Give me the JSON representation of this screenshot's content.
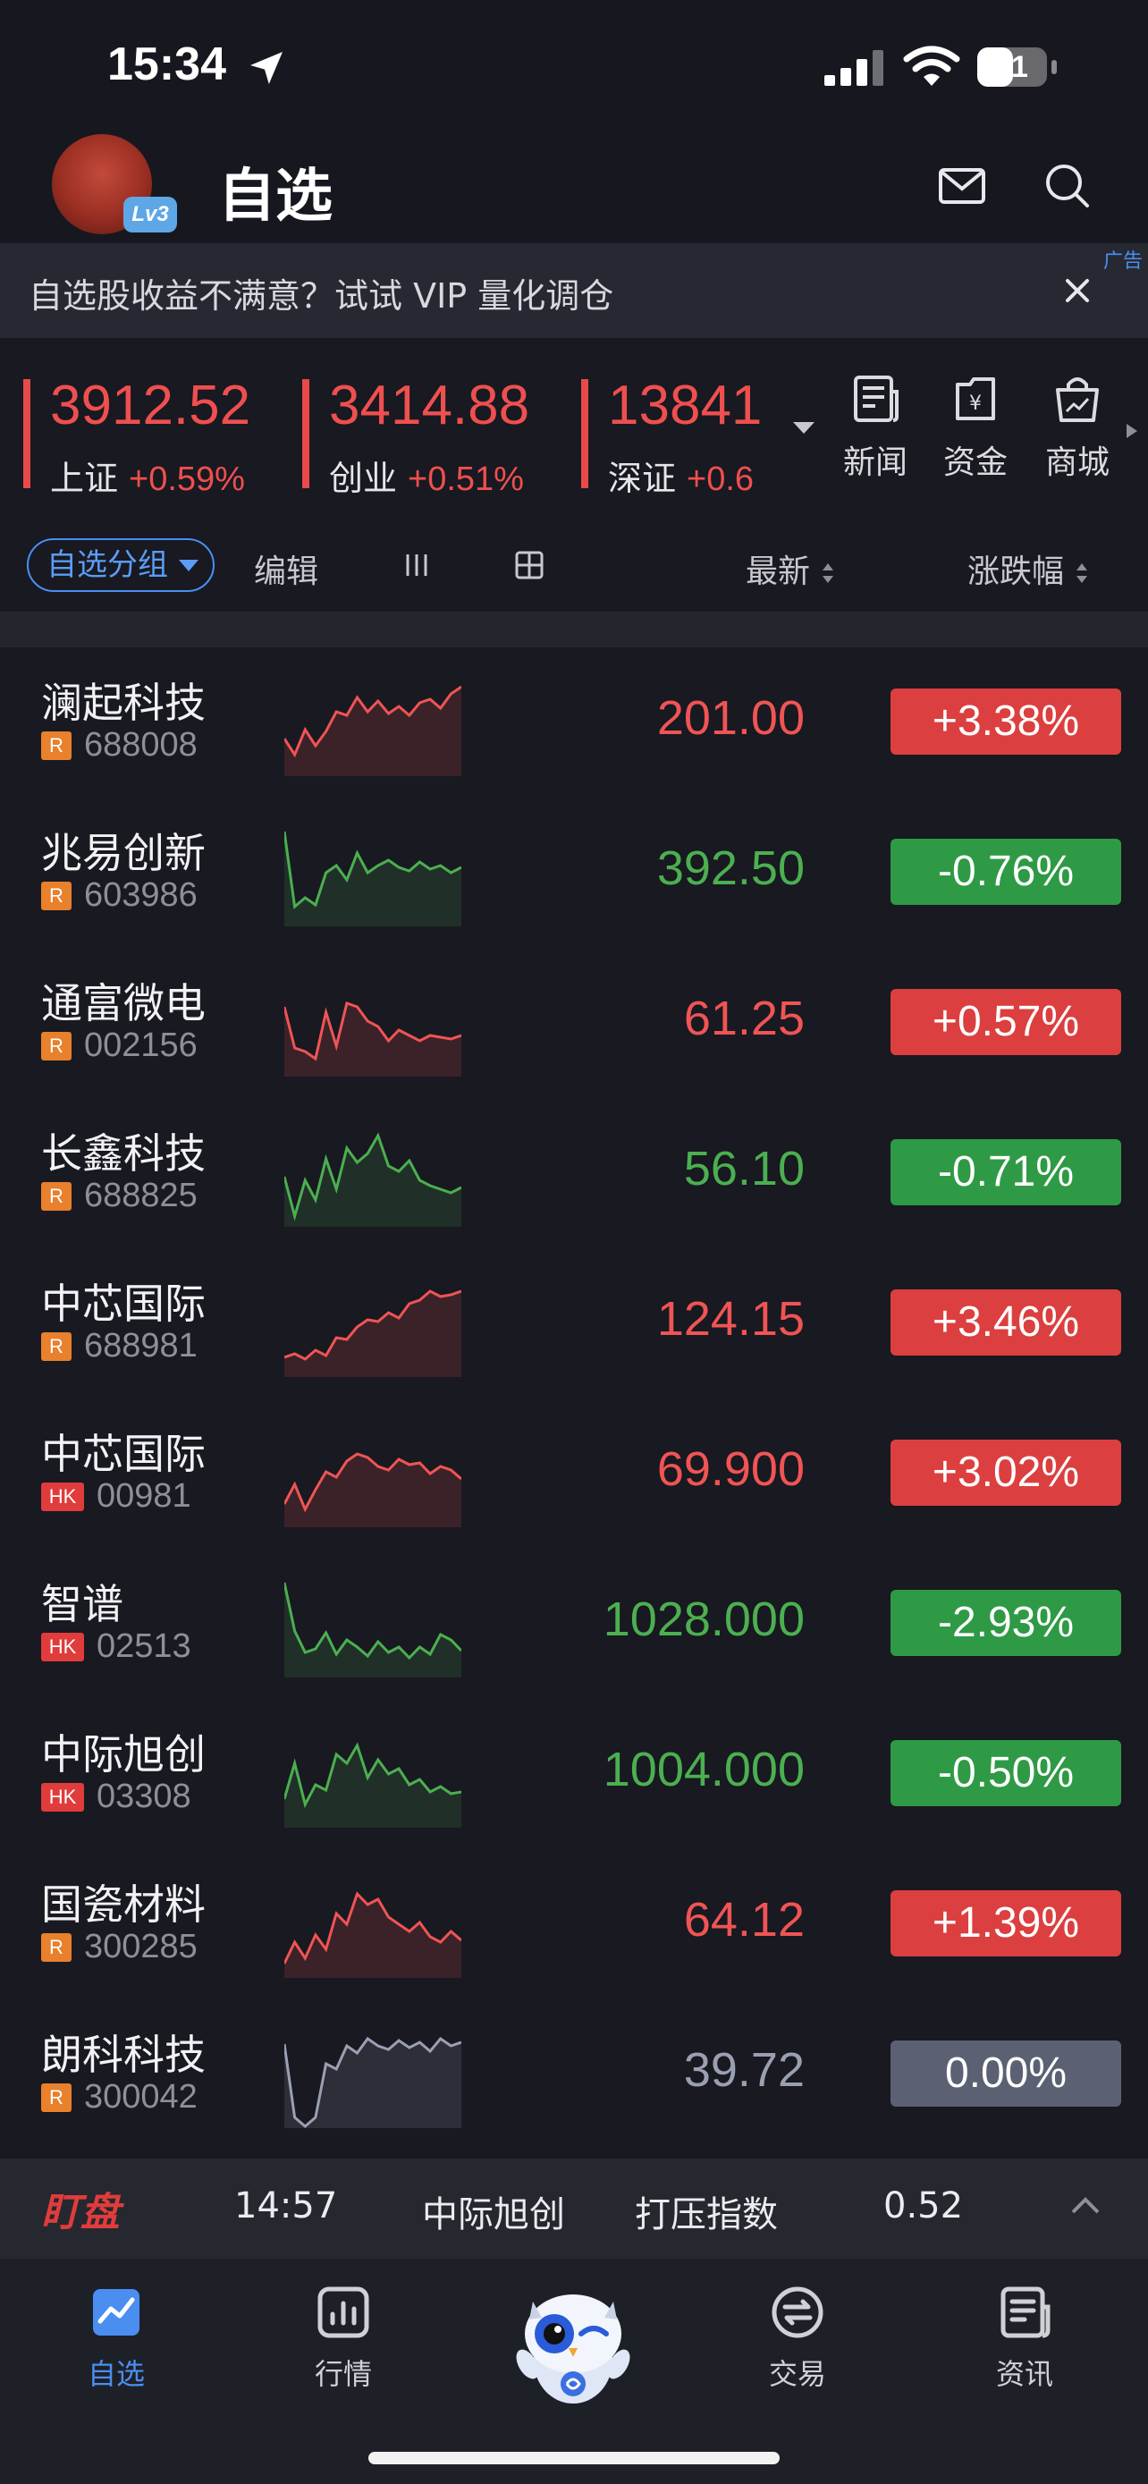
{
  "status_bar": {
    "time": "15:34",
    "battery": "51"
  },
  "header": {
    "title": "自选",
    "level_badge": "Lv3"
  },
  "ad_banner": {
    "text": "自选股收益不满意？试试 VIP 量化调仓",
    "tag": "广告"
  },
  "indices": [
    {
      "value": "3912.52",
      "name": "上证",
      "change": "+0.59%"
    },
    {
      "value": "3414.88",
      "name": "创业",
      "change": "+0.51%"
    },
    {
      "value": "13841",
      "name": "深证",
      "change": "+0.6"
    }
  ],
  "quick_links": [
    {
      "label": "新闻",
      "icon": "news-icon"
    },
    {
      "label": "资金",
      "icon": "funds-icon"
    },
    {
      "label": "商城",
      "icon": "mall-icon"
    }
  ],
  "toolbar": {
    "group_label": "自选分组",
    "edit_label": "编辑",
    "sort_latest": "最新",
    "sort_change": "涨跌幅"
  },
  "colors": {
    "up": "#f05454",
    "down": "#4caf50",
    "flat": "#9aa0b2",
    "accent": "#4a8ef0"
  },
  "stocks": [
    {
      "name": "澜起科技",
      "market": "R",
      "code": "688008",
      "price": "201.00",
      "change": "+3.38%",
      "trend": "up"
    },
    {
      "name": "兆易创新",
      "market": "R",
      "code": "603986",
      "price": "392.50",
      "change": "-0.76%",
      "trend": "down"
    },
    {
      "name": "通富微电",
      "market": "R",
      "code": "002156",
      "price": "61.25",
      "change": "+0.57%",
      "trend": "up"
    },
    {
      "name": "长鑫科技",
      "market": "R",
      "code": "688825",
      "price": "56.10",
      "change": "-0.71%",
      "trend": "down"
    },
    {
      "name": "中芯国际",
      "market": "R",
      "code": "688981",
      "price": "124.15",
      "change": "+3.46%",
      "trend": "up"
    },
    {
      "name": "中芯国际",
      "market": "HK",
      "code": "00981",
      "price": "69.900",
      "change": "+3.02%",
      "trend": "up"
    },
    {
      "name": "智谱",
      "market": "HK",
      "code": "02513",
      "price": "1028.000",
      "change": "-2.93%",
      "trend": "down"
    },
    {
      "name": "中际旭创",
      "market": "HK",
      "code": "03308",
      "price": "1004.000",
      "change": "-0.50%",
      "trend": "down"
    },
    {
      "name": "国瓷材料",
      "market": "R",
      "code": "300285",
      "price": "64.12",
      "change": "+1.39%",
      "trend": "up"
    },
    {
      "name": "朗科科技",
      "market": "R",
      "code": "300042",
      "price": "39.72",
      "change": "0.00%",
      "trend": "flat"
    }
  ],
  "ticker": {
    "logo": "盯盘",
    "time": "14:57",
    "stock": "中际旭创",
    "label": "打压指数",
    "value": "0.52"
  },
  "tabs": [
    {
      "label": "自选",
      "icon": "watchlist-icon",
      "active": true
    },
    {
      "label": "行情",
      "icon": "market-icon",
      "active": false
    },
    {
      "label": "交易",
      "icon": "trade-icon",
      "active": false
    },
    {
      "label": "资讯",
      "icon": "info-icon",
      "active": false
    }
  ]
}
